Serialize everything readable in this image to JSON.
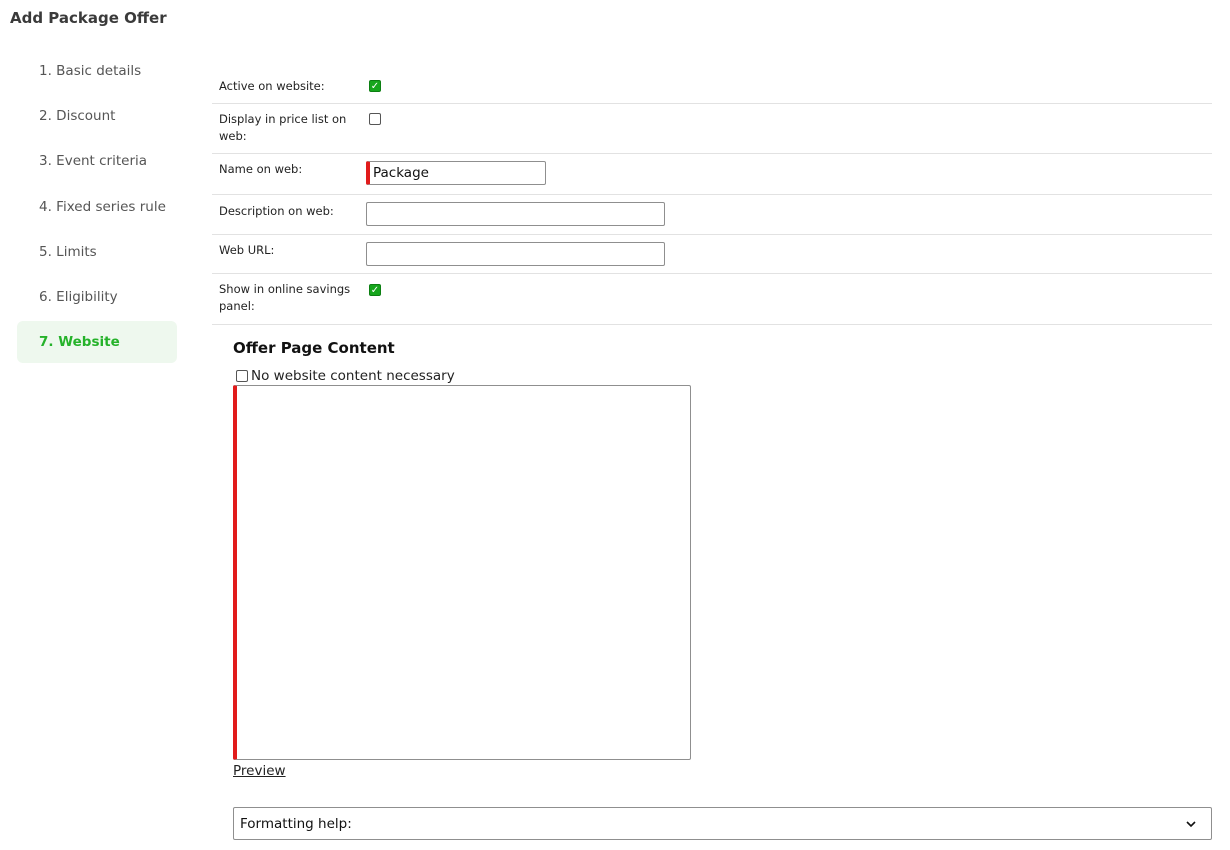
{
  "page": {
    "title": "Add Package Offer"
  },
  "steps": [
    {
      "label": "1. Basic details",
      "active": false
    },
    {
      "label": "2. Discount",
      "active": false
    },
    {
      "label": "3. Event criteria",
      "active": false
    },
    {
      "label": "4. Fixed series rule",
      "active": false
    },
    {
      "label": "5. Limits",
      "active": false
    },
    {
      "label": "6. Eligibility",
      "active": false
    },
    {
      "label": "7. Website",
      "active": true
    }
  ],
  "form": {
    "active_on_website": {
      "label": "Active on website:",
      "checked": true
    },
    "display_in_price_list": {
      "label": "Display in price list on web:",
      "checked": false
    },
    "name_on_web": {
      "label": "Name on web:",
      "value": "Package"
    },
    "description_on_web": {
      "label": "Description on web:",
      "value": ""
    },
    "web_url": {
      "label": "Web URL:",
      "value": ""
    },
    "show_in_savings_panel": {
      "label": "Show in online savings panel:",
      "checked": true
    }
  },
  "offer_content": {
    "title": "Offer Page Content",
    "no_content_label": "No website content necessary",
    "no_content_checked": false,
    "content": "",
    "preview_link": "Preview",
    "formatting_help_label": "Formatting help:"
  },
  "colors": {
    "accent_green": "#25b22a",
    "active_bg": "#eef8ee",
    "checkbox_green": "#16a51c",
    "required_red": "#e11b1b"
  },
  "icons": {
    "checkmark": "check-icon",
    "dropdown": "chevron-down-icon"
  }
}
